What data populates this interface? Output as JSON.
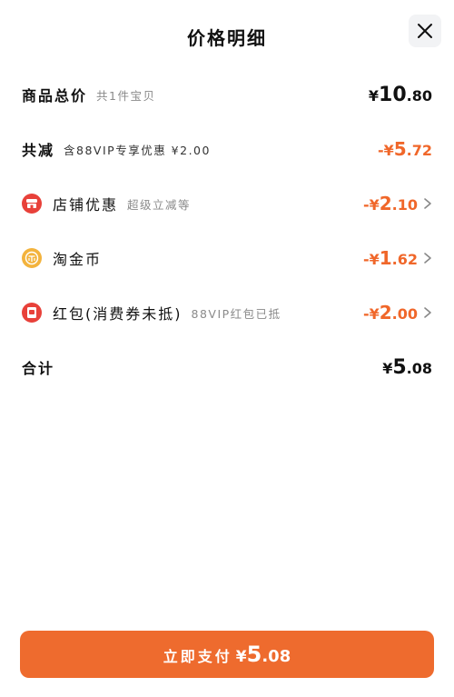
{
  "header": {
    "title": "价格明细",
    "close_icon": "close-icon"
  },
  "rows": {
    "goods_total": {
      "label": "商品总价",
      "sub": "共1件宝贝",
      "currency": "¥",
      "int": "10",
      "dec": ".80"
    },
    "total_discount": {
      "label": "共减",
      "sub": "含88VIP专享优惠 ¥2.00",
      "currency": "-¥",
      "int": "5",
      "dec": ".72"
    },
    "shop_discount": {
      "icon": "shop-icon",
      "label": "店铺优惠",
      "sub": "超级立减等",
      "currency": "-¥",
      "int": "2",
      "dec": ".10"
    },
    "taojinbi": {
      "icon": "coin-icon",
      "label": "淘金币",
      "currency": "-¥",
      "int": "1",
      "dec": ".62"
    },
    "red_packet": {
      "icon": "red-packet-icon",
      "label": "红包(消费券未抵)",
      "sub": "88VIP红包已抵",
      "currency": "-¥",
      "int": "2",
      "dec": ".00"
    },
    "subtotal": {
      "label": "合计",
      "currency": "¥",
      "int": "5",
      "dec": ".08"
    }
  },
  "pay_button": {
    "label": "立即支付",
    "currency": "¥",
    "int": "5",
    "dec": ".08"
  },
  "colors": {
    "accent": "#ee6b2e",
    "discount": "#f0672a",
    "icon_red": "#e8413a",
    "icon_gold": "#f3b33d"
  }
}
